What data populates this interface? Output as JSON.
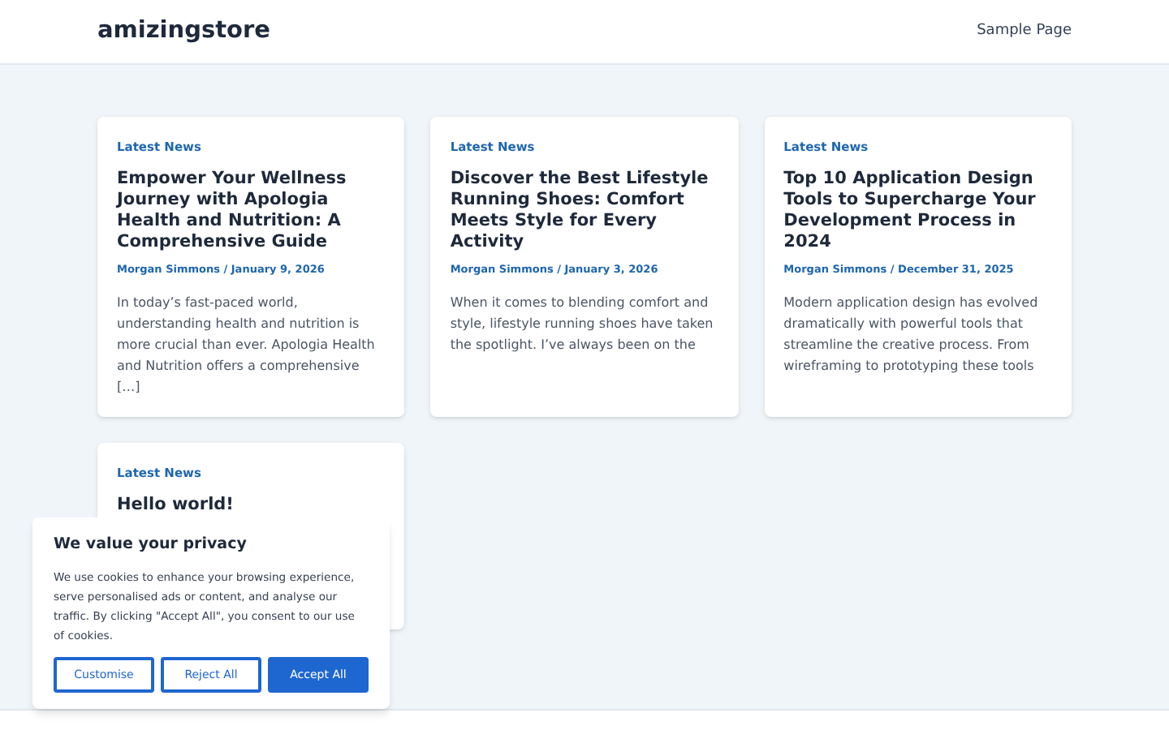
{
  "site": {
    "title": "amizingstore",
    "nav": [
      "Sample Page"
    ]
  },
  "posts": [
    {
      "category": "Latest News",
      "title": "Empower Your Wellness Journey with Apologia Health and Nutrition: A Comprehensive Guide",
      "meta": "Morgan Simmons / January 9, 2026",
      "excerpt": "In today’s fast-paced world, understanding health and nutrition is more crucial than ever. Apologia Health and Nutrition offers a comprehensive […]"
    },
    {
      "category": "Latest News",
      "title": "Discover the Best Lifestyle Running Shoes: Comfort Meets Style for Every Activity",
      "meta": "Morgan Simmons / January 3, 2026",
      "excerpt": "When it comes to blending comfort and style, lifestyle running shoes have taken the spotlight. I’ve always been on the"
    },
    {
      "category": "Latest News",
      "title": "Top 10 Application Design Tools to Supercharge Your Development Process in 2024",
      "meta": "Morgan Simmons / December 31, 2025",
      "excerpt": "Modern application design has evolved dramatically with powerful tools that streamline the creative process. From wireframing to prototyping these tools"
    },
    {
      "category": "Latest News",
      "title": "Hello world!"
    }
  ],
  "cookie_banner": {
    "title": "We value your privacy",
    "text": "We use cookies to enhance your browsing experience, serve personalised ads or content, and analyse our traffic. By clicking \"Accept All\", you consent to our use of cookies.",
    "buttons": [
      {
        "label": "Customise",
        "kind": "outline"
      },
      {
        "label": "Reject All",
        "kind": "outline"
      },
      {
        "label": "Accept All",
        "kind": "primary"
      }
    ]
  }
}
